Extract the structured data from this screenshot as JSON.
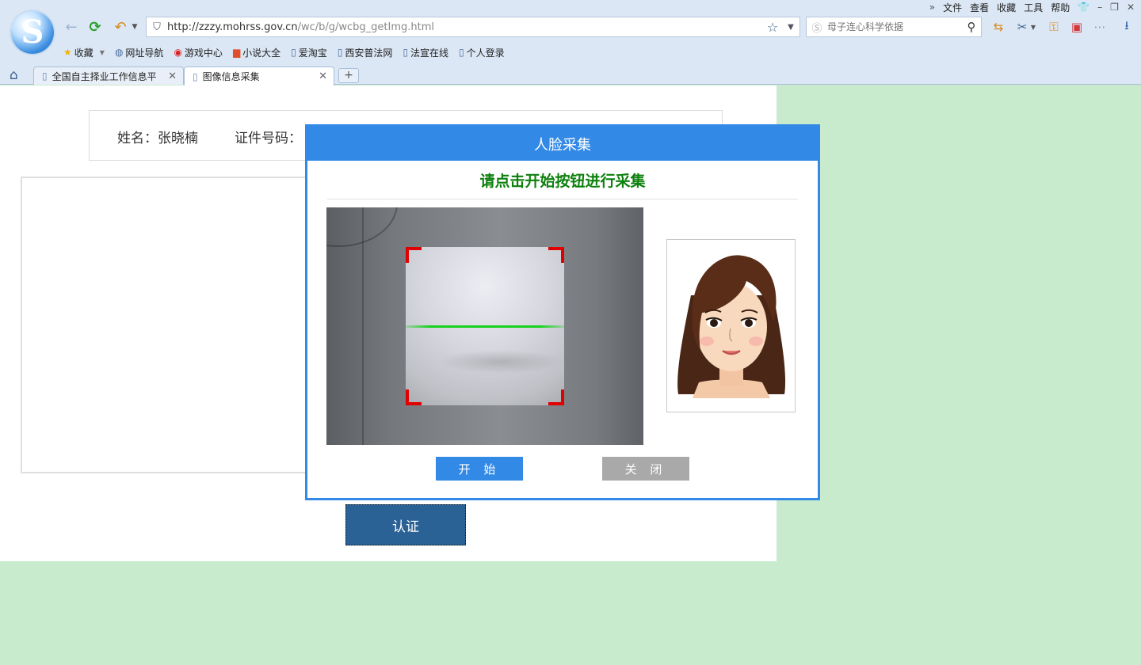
{
  "browser": {
    "menu": [
      "文件",
      "查看",
      "收藏",
      "工具",
      "帮助"
    ],
    "url_host": "http://zzzy.mohrss.gov.cn",
    "url_path": "/wc/b/g/wcbg_getImg.html",
    "search_placeholder": "母子连心科学依据",
    "bookmarks": [
      "收藏",
      "网址导航",
      "游戏中心",
      "小说大全",
      "爱淘宝",
      "西安普法网",
      "法宣在线",
      "个人登录"
    ],
    "tabs": [
      {
        "title": "全国自主择业工作信息平"
      },
      {
        "title": "图像信息采集"
      }
    ],
    "newtab": "+"
  },
  "page": {
    "name_line": "姓名：张晓楠",
    "id_label": "证件号码：",
    "verify_button": "认证"
  },
  "modal": {
    "title": "人脸采集",
    "instruction": "请点击开始按钮进行采集",
    "start_button": "开 始",
    "close_button": "关 闭"
  },
  "colors": {
    "modal_blue": "#3389e6",
    "instruction_green": "#0c800c",
    "scan_line": "#19d21f",
    "corner_red": "#e00000",
    "verify_button": "#2b6296",
    "page_bg": "#c8ebcd"
  }
}
